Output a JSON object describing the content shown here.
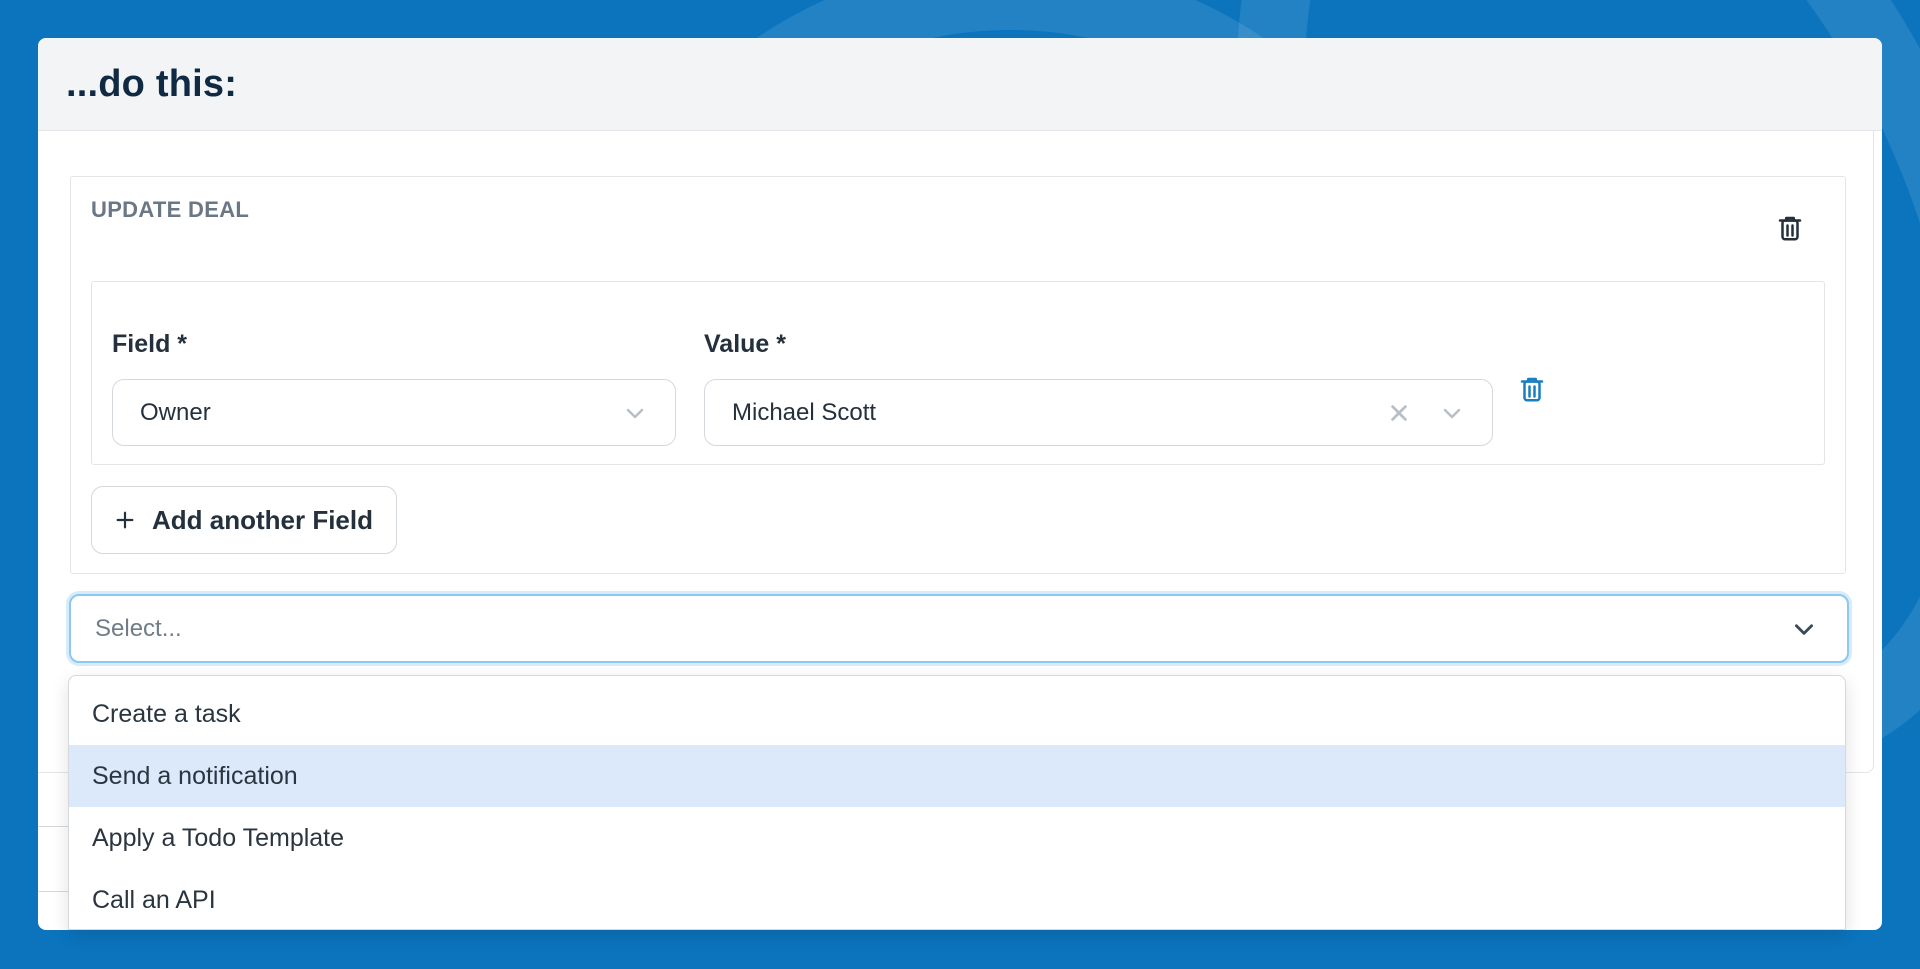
{
  "header": {
    "title": "...do this:"
  },
  "action": {
    "title": "UPDATE DEAL",
    "delete_icon": "trash-icon",
    "fields": {
      "field_label": "Field *",
      "field_value": "Owner",
      "value_label": "Value *",
      "value_value": "Michael Scott"
    },
    "add_field_label": "Add another Field"
  },
  "action_select": {
    "placeholder": "Select...",
    "options": [
      {
        "label": "Create a task",
        "highlighted": false
      },
      {
        "label": "Send a notification",
        "highlighted": true
      },
      {
        "label": "Apply a Todo Template",
        "highlighted": false
      },
      {
        "label": "Call an API",
        "highlighted": false
      }
    ]
  },
  "colors": {
    "background": "#0b74bd",
    "highlight": "#dce9fb",
    "focus_ring": "#8cc8f0",
    "row_delete_icon": "#1a7fc0"
  }
}
